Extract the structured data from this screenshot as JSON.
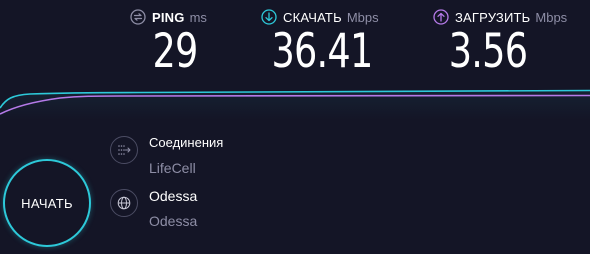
{
  "metrics": {
    "ping": {
      "label": "PING",
      "unit": "ms",
      "value": "29",
      "color": "#8e8ea6"
    },
    "download": {
      "label": "СКАЧАТЬ",
      "unit": "Mbps",
      "value": "36.41",
      "color": "#2dc9d9"
    },
    "upload": {
      "label": "ЗАГРУЗИТЬ",
      "unit": "Mbps",
      "value": "3.56",
      "color": "#b57ae8"
    }
  },
  "start_button": {
    "label": "НАЧАТЬ",
    "color": "#2dc9d9"
  },
  "connection": {
    "title": "Соединения",
    "provider": "LifeCell",
    "icon": "connections-icon"
  },
  "server": {
    "title": "Odessa",
    "location": "Odessa",
    "icon": "globe-icon"
  },
  "colors": {
    "background": "#141526",
    "download_line": "#2dc9d9",
    "upload_line": "#b57ae8",
    "muted_text": "#8e8ea6"
  }
}
